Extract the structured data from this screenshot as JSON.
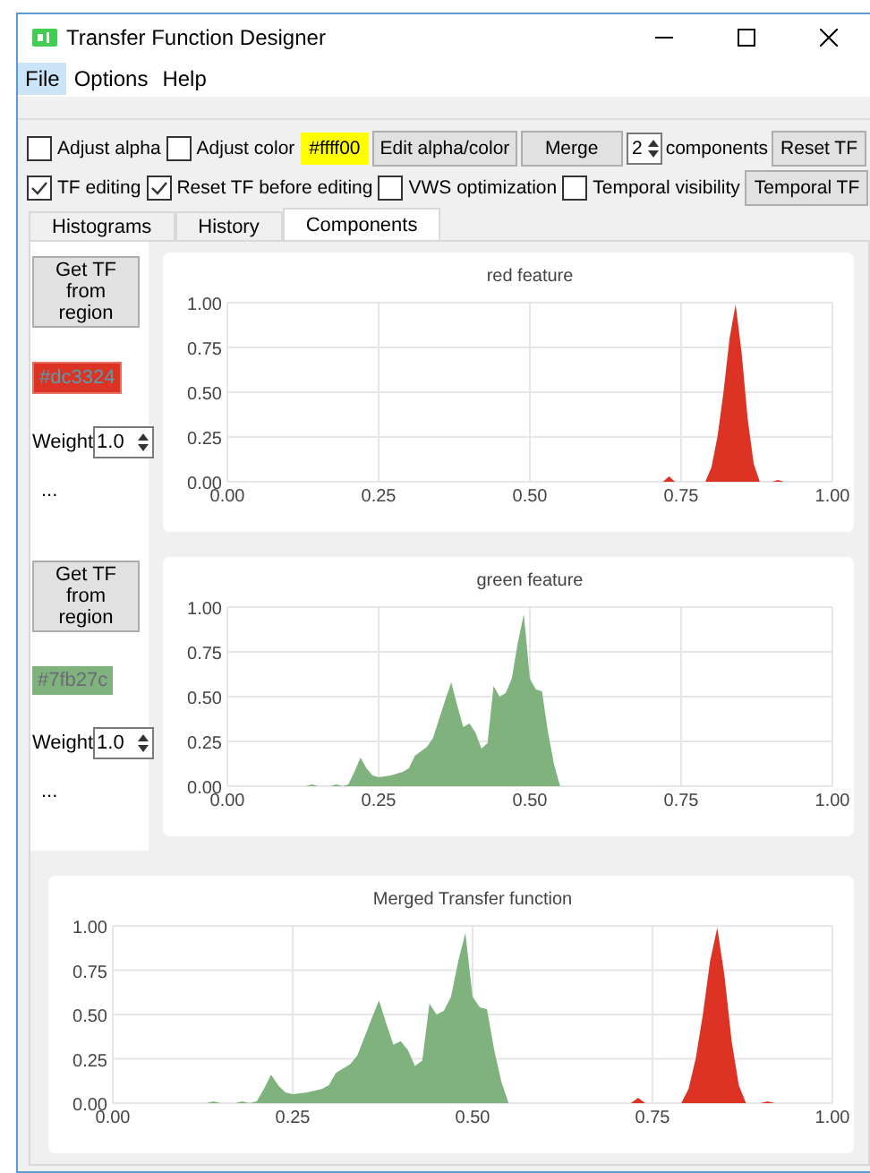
{
  "window": {
    "title": "Transfer Function Designer"
  },
  "menu": [
    {
      "label": "File",
      "selected": true
    },
    {
      "label": "Options",
      "selected": false
    },
    {
      "label": "Help",
      "selected": false
    }
  ],
  "toolbar_rows": [
    [
      {
        "kind": "checkbox",
        "label": "Adjust alpha",
        "checked": false
      },
      {
        "kind": "checkbox",
        "label": "Adjust color",
        "checked": false
      },
      {
        "kind": "swatch",
        "label": "#ffff00",
        "color": "#ffff00"
      },
      {
        "kind": "button",
        "label": "Edit alpha/color"
      },
      {
        "kind": "button",
        "label": "Merge"
      },
      {
        "kind": "spin",
        "value": "2"
      },
      {
        "kind": "label",
        "label": "components"
      },
      {
        "kind": "button",
        "label": "Reset TF"
      }
    ],
    [
      {
        "kind": "checkbox",
        "label": "TF editing",
        "checked": true
      },
      {
        "kind": "checkbox",
        "label": "Reset TF before editing",
        "checked": true
      },
      {
        "kind": "checkbox",
        "label": "VWS optimization",
        "checked": false
      },
      {
        "kind": "checkbox",
        "label": "Temporal visibility",
        "checked": false
      },
      {
        "kind": "button",
        "label": "Temporal TF"
      }
    ]
  ],
  "tabs": [
    {
      "label": "Histograms",
      "selected": false
    },
    {
      "label": "History",
      "selected": false
    },
    {
      "label": "Components",
      "selected": true
    }
  ],
  "components": [
    {
      "button": "Get TF from region",
      "color_label": "#dc3324",
      "color": "#dc3324",
      "weight_label": "Weight",
      "weight": "1.0",
      "more": "...",
      "chart_data": {
        "type": "area",
        "title": "red feature",
        "grid": true,
        "xlim": [
          0,
          1
        ],
        "ylim": [
          0,
          1
        ],
        "xticks": [
          {
            "value": 0,
            "label": "0.00"
          },
          {
            "value": 0.25,
            "label": "0.25"
          },
          {
            "value": 0.5,
            "label": "0.50"
          },
          {
            "value": 0.75,
            "label": "0.75"
          },
          {
            "value": 1,
            "label": "1.00"
          }
        ],
        "yticks": [
          {
            "value": 0,
            "label": "0.00"
          },
          {
            "value": 0.25,
            "label": "0.25"
          },
          {
            "value": 0.5,
            "label": "0.50"
          },
          {
            "value": 0.75,
            "label": "0.75"
          },
          {
            "value": 1,
            "label": "1.00"
          }
        ],
        "x": [
          0.72,
          0.73,
          0.74,
          0.79,
          0.8,
          0.81,
          0.82,
          0.83,
          0.84,
          0.85,
          0.86,
          0.87,
          0.88,
          0.9,
          0.91,
          0.92
        ],
        "series": [
          {
            "color": "#dc3324",
            "values": [
              0,
              0.03,
              0,
              0,
              0.08,
              0.25,
              0.5,
              0.8,
              0.99,
              0.72,
              0.35,
              0.1,
              0,
              0,
              0.01,
              0
            ]
          }
        ]
      }
    },
    {
      "button": "Get TF from region",
      "color_label": "#7fb27c",
      "color": "#7fb27c",
      "weight_label": "Weight",
      "weight": "1.0",
      "more": "...",
      "chart_data": {
        "type": "area",
        "title": "green feature",
        "grid": true,
        "xlim": [
          0,
          1
        ],
        "ylim": [
          0,
          1
        ],
        "xticks": [
          {
            "value": 0,
            "label": "0.00"
          },
          {
            "value": 0.25,
            "label": "0.25"
          },
          {
            "value": 0.5,
            "label": "0.50"
          },
          {
            "value": 0.75,
            "label": "0.75"
          },
          {
            "value": 1,
            "label": "1.00"
          }
        ],
        "yticks": [
          {
            "value": 0,
            "label": "0.00"
          },
          {
            "value": 0.25,
            "label": "0.25"
          },
          {
            "value": 0.5,
            "label": "0.50"
          },
          {
            "value": 0.75,
            "label": "0.75"
          },
          {
            "value": 1,
            "label": "1.00"
          }
        ],
        "x": [
          0.13,
          0.14,
          0.15,
          0.17,
          0.18,
          0.19,
          0.2,
          0.21,
          0.22,
          0.23,
          0.24,
          0.25,
          0.27,
          0.29,
          0.3,
          0.31,
          0.33,
          0.34,
          0.36,
          0.37,
          0.38,
          0.39,
          0.4,
          0.41,
          0.42,
          0.43,
          0.44,
          0.45,
          0.46,
          0.47,
          0.48,
          0.49,
          0.5,
          0.51,
          0.52,
          0.53,
          0.54,
          0.55
        ],
        "series": [
          {
            "color": "#7fb27c",
            "values": [
              0,
              0.01,
              0,
              0,
              0.01,
              0,
              0.01,
              0.08,
              0.16,
              0.1,
              0.06,
              0.05,
              0.06,
              0.08,
              0.1,
              0.17,
              0.22,
              0.27,
              0.48,
              0.58,
              0.45,
              0.33,
              0.35,
              0.3,
              0.21,
              0.24,
              0.56,
              0.5,
              0.52,
              0.6,
              0.8,
              0.96,
              0.6,
              0.54,
              0.53,
              0.3,
              0.12,
              0
            ]
          }
        ]
      }
    }
  ],
  "merged": {
    "chart_data": {
      "type": "area",
      "title": "Merged Transfer function",
      "grid": true,
      "xlim": [
        0,
        1
      ],
      "ylim": [
        0,
        1
      ],
      "xticks": [
        {
          "value": 0,
          "label": "0.00"
        },
        {
          "value": 0.25,
          "label": "0.25"
        },
        {
          "value": 0.5,
          "label": "0.50"
        },
        {
          "value": 0.75,
          "label": "0.75"
        },
        {
          "value": 1,
          "label": "1.00"
        }
      ],
      "yticks": [
        {
          "value": 0,
          "label": "0.00"
        },
        {
          "value": 0.25,
          "label": "0.25"
        },
        {
          "value": 0.5,
          "label": "0.50"
        },
        {
          "value": 0.75,
          "label": "0.75"
        },
        {
          "value": 1,
          "label": "1.00"
        }
      ],
      "x": [
        0.13,
        0.14,
        0.15,
        0.17,
        0.18,
        0.19,
        0.2,
        0.21,
        0.22,
        0.23,
        0.24,
        0.25,
        0.27,
        0.29,
        0.3,
        0.31,
        0.33,
        0.34,
        0.36,
        0.37,
        0.38,
        0.39,
        0.4,
        0.41,
        0.42,
        0.43,
        0.44,
        0.45,
        0.46,
        0.47,
        0.48,
        0.49,
        0.5,
        0.51,
        0.52,
        0.53,
        0.54,
        0.55,
        0.72,
        0.73,
        0.74,
        0.79,
        0.8,
        0.81,
        0.82,
        0.83,
        0.84,
        0.85,
        0.86,
        0.87,
        0.88,
        0.9,
        0.91,
        0.92
      ],
      "series": [
        {
          "color": "#7fb27c",
          "values": [
            0,
            0.01,
            0,
            0,
            0.01,
            0,
            0.01,
            0.08,
            0.16,
            0.1,
            0.06,
            0.05,
            0.06,
            0.08,
            0.1,
            0.17,
            0.22,
            0.27,
            0.48,
            0.58,
            0.45,
            0.33,
            0.35,
            0.3,
            0.21,
            0.24,
            0.56,
            0.5,
            0.52,
            0.6,
            0.8,
            0.96,
            0.6,
            0.54,
            0.53,
            0.3,
            0.12,
            0,
            null,
            null,
            null,
            null,
            null,
            null,
            null,
            null,
            null,
            null,
            null,
            null,
            null,
            null,
            null,
            null
          ]
        },
        {
          "color": "#dc3324",
          "values": [
            null,
            null,
            null,
            null,
            null,
            null,
            null,
            null,
            null,
            null,
            null,
            null,
            null,
            null,
            null,
            null,
            null,
            null,
            null,
            null,
            null,
            null,
            null,
            null,
            null,
            null,
            null,
            null,
            null,
            null,
            null,
            null,
            null,
            null,
            null,
            null,
            null,
            null,
            0,
            0.03,
            0,
            0,
            0.08,
            0.25,
            0.5,
            0.8,
            0.99,
            0.72,
            0.35,
            0.1,
            0,
            0,
            0.01,
            0
          ]
        }
      ]
    }
  }
}
